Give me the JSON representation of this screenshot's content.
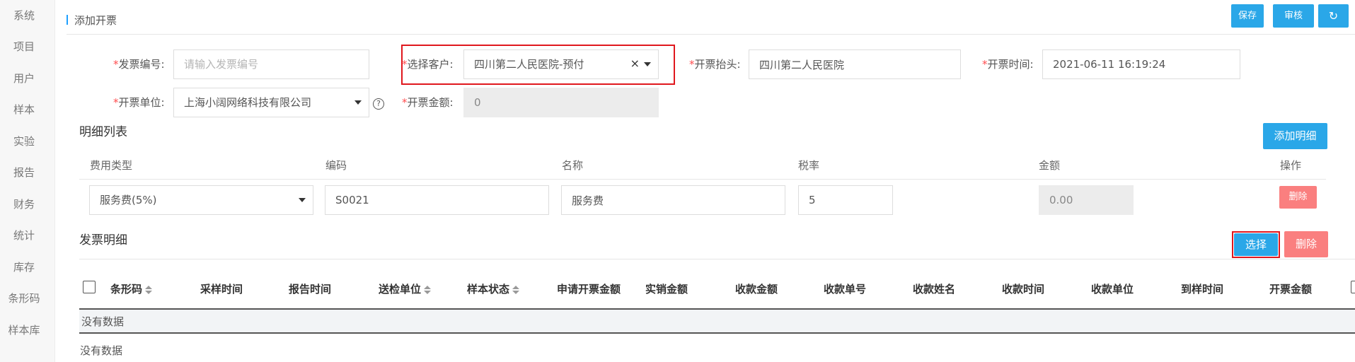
{
  "sidebar": {
    "items": [
      {
        "label": "系统"
      },
      {
        "label": "项目"
      },
      {
        "label": "用户"
      },
      {
        "label": "样本"
      },
      {
        "label": "实验"
      },
      {
        "label": "报告"
      },
      {
        "label": "财务"
      },
      {
        "label": "统计"
      },
      {
        "label": "库存"
      },
      {
        "label": "条形码"
      },
      {
        "label": "样本库"
      }
    ]
  },
  "header": {
    "title": "添加开票",
    "save_label": "保存",
    "audit_label": "审核",
    "refresh_icon": "refresh-icon",
    "refresh_glyph": "↻"
  },
  "form": {
    "required_mark": "*",
    "invoice_no": {
      "label": "发票编号:",
      "value": "",
      "placeholder": "请输入发票编号"
    },
    "customer": {
      "label": "选择客户:",
      "value": "四川第二人民医院-预付",
      "clear_glyph": "×"
    },
    "invoice_header": {
      "label": "开票抬头:",
      "value": "四川第二人民医院"
    },
    "invoice_time": {
      "label": "开票时间:",
      "value": "2021-06-11 16:19:24"
    },
    "issuer": {
      "label": "开票单位:",
      "value": "上海小阔网络科技有限公司",
      "help_glyph": "?"
    },
    "amount": {
      "label": "开票金额:",
      "value": "0"
    }
  },
  "detail": {
    "title": "明细列表",
    "add_label": "添加明细",
    "columns": [
      "费用类型",
      "编码",
      "名称",
      "税率",
      "金额",
      "操作"
    ],
    "rows": [
      {
        "fee_type": "服务费(5%)",
        "code": "S0021",
        "name": "服务费",
        "tax_rate": "5",
        "amount": "0.00",
        "delete_label": "删除"
      }
    ]
  },
  "invoice_detail": {
    "title": "发票明细",
    "select_label": "选择",
    "delete_label": "删除",
    "columns": [
      "条形码",
      "采样时间",
      "报告时间",
      "送检单位",
      "样本状态",
      "申请开票金额",
      "实销金额",
      "收款金额",
      "收款单号",
      "收款姓名",
      "收款时间",
      "收款单位",
      "到样时间",
      "开票金额"
    ],
    "empty_text_1": "没有数据",
    "empty_text_2": "没有数据"
  },
  "colors": {
    "primary": "#2aa7e8",
    "danger": "#fa7f7f",
    "highlight": "#e0171d",
    "required": "#ff4d4f"
  }
}
